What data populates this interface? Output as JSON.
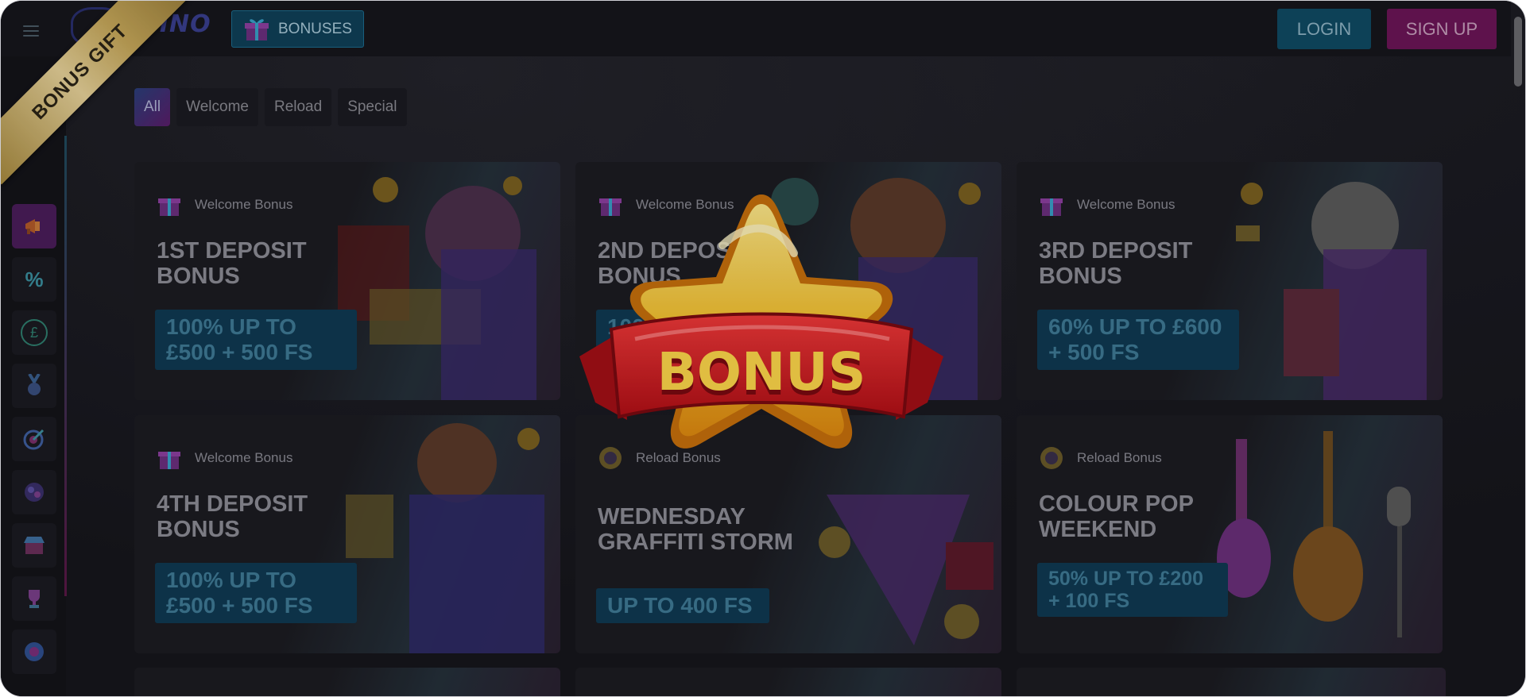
{
  "header": {
    "logo_text": "CASINO",
    "bonuses_label": "BONUSES",
    "login_label": "LOGIN",
    "signup_label": "SIGN UP"
  },
  "sidebar": {
    "items": [
      {
        "icon": "megaphone-icon",
        "active": true
      },
      {
        "icon": "percent-icon",
        "glyph": "%"
      },
      {
        "icon": "pound-coin-icon",
        "glyph": "£"
      },
      {
        "icon": "medal-icon"
      },
      {
        "icon": "target-icon"
      },
      {
        "icon": "slot-reels-icon"
      },
      {
        "icon": "shop-icon"
      },
      {
        "icon": "trophy-icon"
      },
      {
        "icon": "roulette-icon"
      }
    ]
  },
  "filters": {
    "tabs": [
      {
        "label": "All",
        "active": true
      },
      {
        "label": "Welcome"
      },
      {
        "label": "Reload"
      },
      {
        "label": "Special"
      }
    ]
  },
  "cards": [
    {
      "tag": "Welcome Bonus",
      "title": "1ST DEPOSIT BONUS",
      "offer": "100% UP TO £500 + 500 FS"
    },
    {
      "tag": "Welcome Bonus",
      "title": "2ND DEPOSIT BONUS",
      "offer": "100% UP TO £500 + 500 FS"
    },
    {
      "tag": "Welcome Bonus",
      "title": "3RD DEPOSIT BONUS",
      "offer": "60% UP TO £600 + 500 FS"
    },
    {
      "tag": "Welcome Bonus",
      "title": "4TH DEPOSIT BONUS",
      "offer": "100% UP TO £500 + 500 FS"
    },
    {
      "tag": "Reload Bonus",
      "title": "WEDNESDAY GRAFFITI STORM",
      "offer": "UP TO 400 FS"
    },
    {
      "tag": "Reload Bonus",
      "title": "COLOUR POP WEEKEND",
      "offer": "50% UP TO £200 + 100 FS"
    }
  ],
  "ribbon_label": "BONUS GIFT",
  "badge_label": "BONUS",
  "colors": {
    "background": "#16161c",
    "login": "#0f4a63",
    "signup": "#6b1557",
    "offer": "#0f3952",
    "ribbon_gold": "#e8d39a",
    "star_gold": "#f5c230",
    "banner_red": "#d4151d"
  }
}
